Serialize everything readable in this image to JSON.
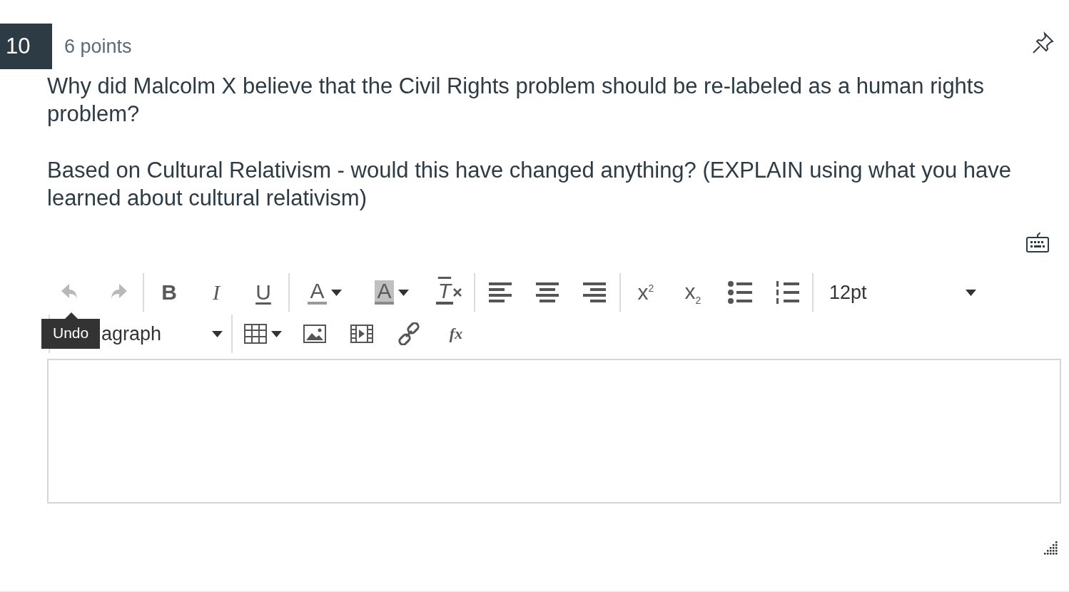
{
  "question": {
    "number": "10",
    "points": "6 points",
    "pinned": false,
    "paragraphs": [
      "Why did Malcolm X believe that the Civil Rights problem should be re-labeled as a human rights problem?",
      "Based on Cultural Relativism - would this have changed anything?  (EXPLAIN using what you have learned about cultural relativism)"
    ]
  },
  "toolbar": {
    "rows": [
      [
        {
          "kind": "undo",
          "disabled": true
        },
        {
          "kind": "redo",
          "disabled": true
        },
        {
          "kind": "separator"
        },
        {
          "kind": "bold",
          "label": "B"
        },
        {
          "kind": "italic",
          "label": "I"
        },
        {
          "kind": "underline",
          "label": "U"
        },
        {
          "kind": "separator"
        },
        {
          "kind": "text-color",
          "label": "A"
        },
        {
          "kind": "background-color",
          "label": "A"
        },
        {
          "kind": "clear-format",
          "label": "T"
        },
        {
          "kind": "separator"
        },
        {
          "kind": "align-left"
        },
        {
          "kind": "align-center"
        },
        {
          "kind": "align-right"
        },
        {
          "kind": "separator"
        },
        {
          "kind": "superscript",
          "label": "x$^{2}$"
        },
        {
          "kind": "subscript",
          "label": "x$_{2}$"
        },
        {
          "kind": "bullet-list"
        },
        {
          "kind": "numbered-list"
        },
        {
          "kind": "separator"
        },
        {
          "kind": "font-size",
          "label": "12pt"
        }
      ],
      [
        {
          "kind": "separator"
        },
        {
          "kind": "block-format",
          "label": "agraph"
        },
        {
          "kind": "separator"
        },
        {
          "kind": "table"
        },
        {
          "kind": "image"
        },
        {
          "kind": "media"
        },
        {
          "kind": "link"
        },
        {
          "kind": "equation",
          "label": "fx"
        }
      ]
    ],
    "tooltip": "Undo"
  }
}
